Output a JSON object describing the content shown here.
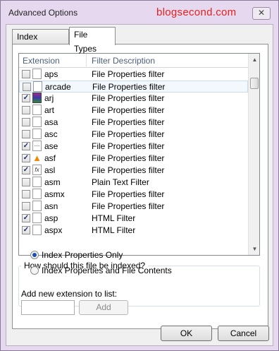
{
  "window": {
    "title": "Advanced Options",
    "watermark": "blogsecond.com",
    "close_glyph": "✕"
  },
  "tabs": [
    {
      "label": "Index Settings"
    },
    {
      "label": "File Types"
    }
  ],
  "list": {
    "columns": {
      "extension": "Extension",
      "description": "Filter Description"
    },
    "rows": [
      {
        "ext": "aps",
        "desc": "File Properties filter",
        "checked": false,
        "icon": "file-icon"
      },
      {
        "ext": "arcade",
        "desc": "File Properties filter",
        "checked": false,
        "icon": "file-icon",
        "selected": true
      },
      {
        "ext": "arj",
        "desc": "File Properties filter",
        "checked": true,
        "icon": "archive-icon"
      },
      {
        "ext": "art",
        "desc": "File Properties filter",
        "checked": false,
        "icon": "file-icon"
      },
      {
        "ext": "asa",
        "desc": "File Properties filter",
        "checked": false,
        "icon": "file-icon"
      },
      {
        "ext": "asc",
        "desc": "File Properties filter",
        "checked": false,
        "icon": "file-icon"
      },
      {
        "ext": "ase",
        "desc": "File Properties filter",
        "checked": true,
        "icon": "dotted-file-icon"
      },
      {
        "ext": "asf",
        "desc": "File Properties filter",
        "checked": true,
        "icon": "vlc-cone-icon"
      },
      {
        "ext": "asl",
        "desc": "File Properties filter",
        "checked": true,
        "icon": "fx-file-icon"
      },
      {
        "ext": "asm",
        "desc": "Plain Text Filter",
        "checked": false,
        "icon": "file-icon"
      },
      {
        "ext": "asmx",
        "desc": "File Properties filter",
        "checked": false,
        "icon": "file-icon"
      },
      {
        "ext": "asn",
        "desc": "File Properties filter",
        "checked": false,
        "icon": "file-icon"
      },
      {
        "ext": "asp",
        "desc": "HTML Filter",
        "checked": true,
        "icon": "file-icon"
      },
      {
        "ext": "aspx",
        "desc": "HTML Filter",
        "checked": true,
        "icon": "file-icon"
      }
    ]
  },
  "index_group": {
    "title": "How should this file be indexed?",
    "options": [
      {
        "label": "Index Properties Only",
        "selected": true
      },
      {
        "label": "Index Properties and File Contents",
        "selected": false
      }
    ]
  },
  "add_extension": {
    "label": "Add new extension to list:",
    "input_value": "",
    "button_label": "Add"
  },
  "buttons": {
    "ok": "OK",
    "cancel": "Cancel"
  }
}
